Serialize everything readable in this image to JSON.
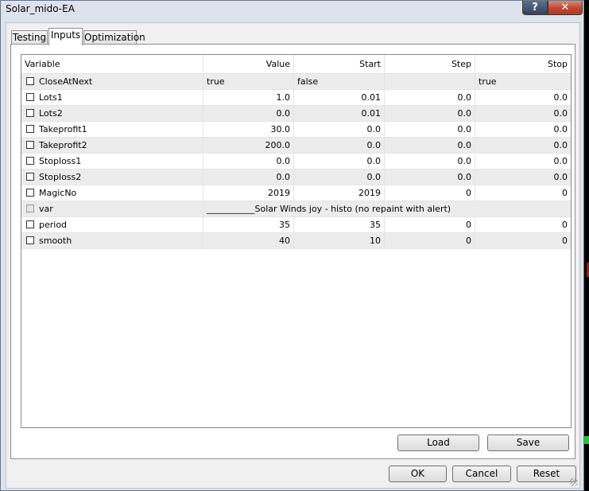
{
  "window": {
    "title": "Solar_mido-EA",
    "help_label": "?",
    "close_label": "✕"
  },
  "tabs": [
    {
      "label": "Testing"
    },
    {
      "label": "Inputs"
    },
    {
      "label": "Optimization"
    }
  ],
  "active_tab": "Inputs",
  "table": {
    "columns": {
      "variable": "Variable",
      "value": "Value",
      "start": "Start",
      "step": "Step",
      "stop": "Stop"
    },
    "rows": [
      {
        "name": "CloseAtNext",
        "value": "true",
        "start": "false",
        "step": "",
        "stop": "true",
        "checked": false
      },
      {
        "name": "Lots1",
        "value": "1.0",
        "start": "0.01",
        "step": "0.0",
        "stop": "0.0",
        "checked": false
      },
      {
        "name": "Lots2",
        "value": "0.0",
        "start": "0.01",
        "step": "0.0",
        "stop": "0.0",
        "checked": false
      },
      {
        "name": "Takeprofit1",
        "value": "30.0",
        "start": "0.0",
        "step": "0.0",
        "stop": "0.0",
        "checked": false
      },
      {
        "name": "Takeprofit2",
        "value": "200.0",
        "start": "0.0",
        "step": "0.0",
        "stop": "0.0",
        "checked": false
      },
      {
        "name": "Stoploss1",
        "value": "0.0",
        "start": "0.0",
        "step": "0.0",
        "stop": "0.0",
        "checked": false
      },
      {
        "name": "Stoploss2",
        "value": "0.0",
        "start": "0.0",
        "step": "0.0",
        "stop": "0.0",
        "checked": false
      },
      {
        "name": "MagicNo",
        "value": "2019",
        "start": "2019",
        "step": "0",
        "stop": "0",
        "checked": false
      },
      {
        "name": "var",
        "span_value": "___________Solar Winds joy - histo (no repaint with alert)",
        "checked": false,
        "disabled": true
      },
      {
        "name": "period",
        "value": "35",
        "start": "35",
        "step": "0",
        "stop": "0",
        "checked": false
      },
      {
        "name": "smooth",
        "value": "40",
        "start": "10",
        "step": "0",
        "stop": "0",
        "checked": false
      }
    ]
  },
  "buttons": {
    "load": "Load",
    "save": "Save",
    "ok": "OK",
    "cancel": "Cancel",
    "reset": "Reset"
  },
  "colors": {
    "close_button": "#c04530",
    "row_alt": "#ececec",
    "dialog_bg": "#dde3ec"
  }
}
